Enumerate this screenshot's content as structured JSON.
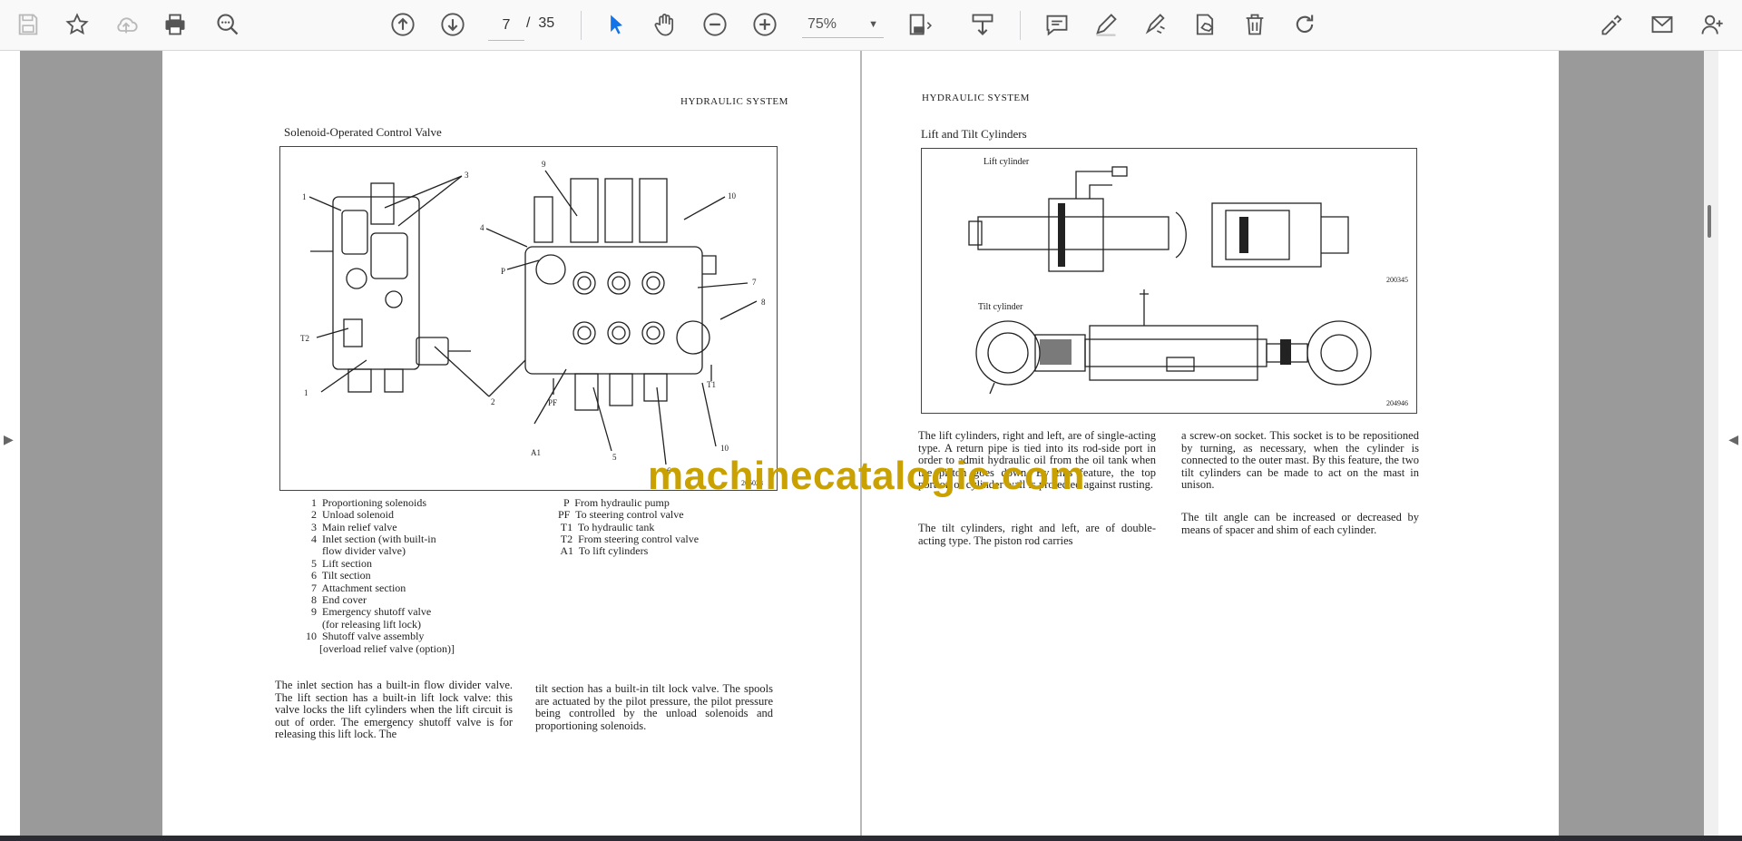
{
  "toolbar": {
    "current_page": "7",
    "page_separator": "/",
    "total_pages": "35",
    "zoom_value": "75%",
    "icons": [
      "save-icon",
      "bookmark-star-icon",
      "upload-cloud-icon",
      "print-icon",
      "zoom-search-icon",
      "page-up-icon",
      "page-down-icon",
      "select-pointer-icon",
      "hand-pan-icon",
      "zoom-out-icon",
      "zoom-in-icon",
      "fit-page-icon",
      "scroll-mode-icon",
      "comment-icon",
      "pen-icon",
      "highlighter-icon",
      "stamp-icon",
      "trash-icon",
      "redo-icon",
      "sign-icon",
      "email-icon",
      "add-user-icon"
    ]
  },
  "left_page": {
    "header": "HYDRAULIC SYSTEM",
    "title": "Solenoid-Operated Control Valve",
    "figure_number": "205023",
    "callouts": [
      "1",
      "3",
      "9",
      "10",
      "4",
      "P",
      "7",
      "8",
      "T2",
      "1",
      "2",
      "PF",
      "A1",
      "5",
      "6",
      "T1",
      "10"
    ],
    "legend_left": [
      "1  Proportioning solenoids",
      "2  Unload solenoid",
      "3  Main relief valve",
      "4  Inlet section (with built-in",
      "    flow divider valve)",
      "5  Lift section",
      "6  Tilt section",
      "7  Attachment section",
      "8  End cover",
      "9  Emergency shutoff valve",
      "    (for releasing lift lock)",
      "10  Shutoff valve assembly",
      "     [overload relief valve (option)]"
    ],
    "legend_right": [
      "  P  From hydraulic pump",
      "PF  To steering control valve",
      " T1  To hydraulic tank",
      " T2  From steering control valve",
      " A1  To lift cylinders"
    ],
    "para1": "The inlet section has a built-in flow divider valve. The lift section has a built-in lift lock valve: this valve locks the lift cylinders when the lift circuit is out of order. The emergency shutoff valve is for releasing this lift lock. The",
    "para2": "tilt section has a built-in tilt lock valve. The spools are actuated by the pilot pressure, the pilot pressure being controlled by the unload solenoids and proportioning solenoids."
  },
  "right_page": {
    "header": "HYDRAULIC SYSTEM",
    "title": "Lift and Tilt Cylinders",
    "lift_label": "Lift cylinder",
    "lift_fig": "200345",
    "tilt_label": "Tilt cylinder",
    "tilt_fig": "204946",
    "para1": "The lift cylinders, right and left, are of single-acting type. A return pipe is tied into its rod-side port in order to admit hydraulic oil from the oil tank when the piston goes down. By this feature, the top portion of cylinder wall is protected against rusting.",
    "para2": "The tilt cylinders, right and left, are of double-acting type. The piston rod carries",
    "para3": "a screw-on socket. This socket is to be repositioned by turning, as necessary, when the cylinder is connected to the outer mast. By this feature, the two tilt cylinders can be made to act on the mast in unison.",
    "para4": "The tilt angle can be increased or decreased by means of spacer and shim of each cylinder."
  },
  "watermark": "machinecatalogic.com"
}
